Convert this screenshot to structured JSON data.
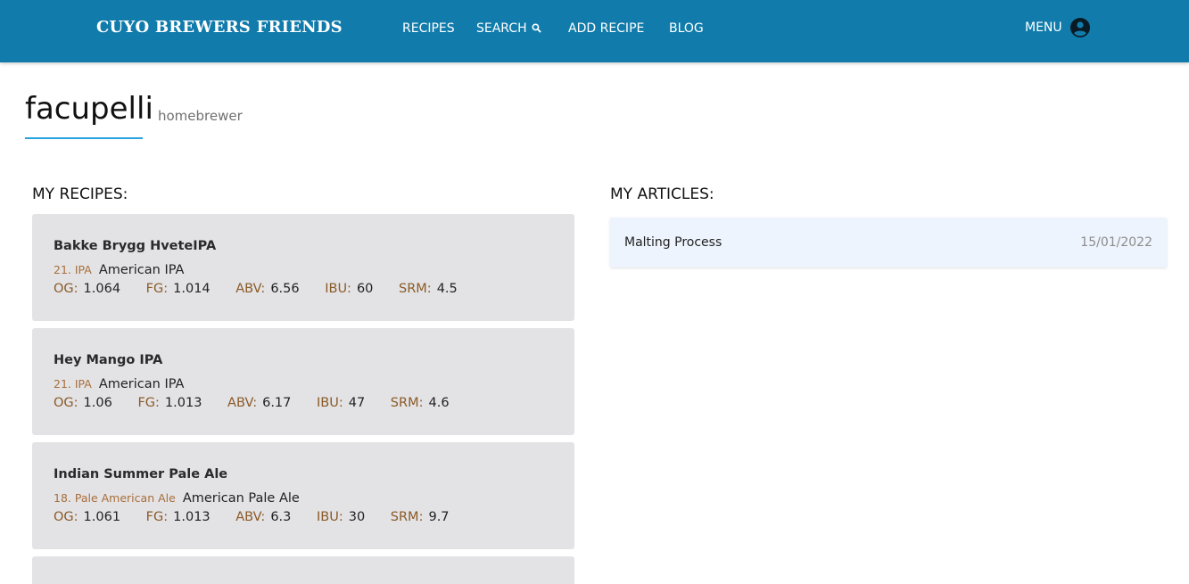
{
  "header": {
    "brand": "CUYO BREWERS FRIENDS",
    "nav": {
      "recipes": "RECIPES",
      "search": "SEARCH",
      "add_recipe": "ADD RECIPE",
      "blog": "BLOG"
    },
    "menu_label": "MENU",
    "search_icon": "search-icon",
    "account_icon": "account-circle-icon"
  },
  "profile": {
    "username": "facupelli",
    "role": "homebrewer"
  },
  "recipes_section": {
    "title": "MY RECIPES:",
    "items": [
      {
        "name": "Bakke Brygg HveteIPA",
        "style_code": "21. IPA",
        "style_name": "American IPA",
        "stats": [
          {
            "label": "OG:",
            "value": "1.064"
          },
          {
            "label": "FG:",
            "value": "1.014"
          },
          {
            "label": "ABV:",
            "value": "6.56"
          },
          {
            "label": "IBU:",
            "value": "60"
          },
          {
            "label": "SRM:",
            "value": "4.5"
          }
        ]
      },
      {
        "name": "Hey Mango IPA",
        "style_code": "21. IPA",
        "style_name": "American IPA",
        "stats": [
          {
            "label": "OG:",
            "value": "1.06"
          },
          {
            "label": "FG:",
            "value": "1.013"
          },
          {
            "label": "ABV:",
            "value": "6.17"
          },
          {
            "label": "IBU:",
            "value": "47"
          },
          {
            "label": "SRM:",
            "value": "4.6"
          }
        ]
      },
      {
        "name": "Indian Summer Pale Ale",
        "style_code": "18. Pale American Ale",
        "style_name": "American Pale Ale",
        "stats": [
          {
            "label": "OG:",
            "value": "1.061"
          },
          {
            "label": "FG:",
            "value": "1.013"
          },
          {
            "label": "ABV:",
            "value": "6.3"
          },
          {
            "label": "IBU:",
            "value": "30"
          },
          {
            "label": "SRM:",
            "value": "9.7"
          }
        ]
      }
    ]
  },
  "articles_section": {
    "title": "MY ARTICLES:",
    "items": [
      {
        "title": "Malting Process",
        "date": "15/01/2022"
      }
    ]
  },
  "colors": {
    "header_bg": "#117cab",
    "accent_underline": "#29a3e0",
    "card_bg": "#e3e3e6",
    "article_bg": "#edf4fd",
    "style_code": "#a86e3a",
    "stat_label": "#8a5a26"
  }
}
